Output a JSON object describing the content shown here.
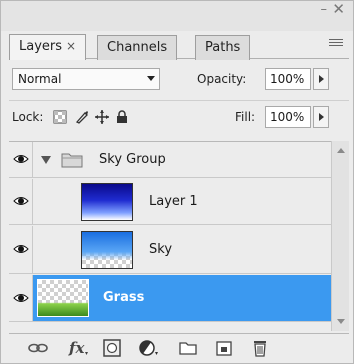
{
  "window": {
    "minimize_glyph": "–",
    "close_glyph": "✕"
  },
  "tabs": [
    {
      "label": "Layers",
      "close_glyph": "×",
      "active": true
    },
    {
      "label": "Channels",
      "active": false
    },
    {
      "label": "Paths",
      "active": false
    }
  ],
  "blend": {
    "mode": "Normal",
    "opacity_label": "Opacity:",
    "opacity_value": "100%",
    "fill_label": "Fill:",
    "fill_value": "100%"
  },
  "lock": {
    "label": "Lock:",
    "icons": [
      "lock-transparent-pixels-icon",
      "lock-image-pixels-icon",
      "lock-position-icon",
      "lock-all-icon"
    ]
  },
  "layers": [
    {
      "name": "Sky Group",
      "type": "group",
      "visible": true,
      "expanded": true,
      "selected": false
    },
    {
      "name": "Layer 1",
      "type": "layer",
      "visible": true,
      "selected": false,
      "thumb": "blue-gradient"
    },
    {
      "name": "Sky",
      "type": "layer",
      "visible": true,
      "selected": false,
      "thumb": "sky-gradient-transparent"
    },
    {
      "name": "Grass",
      "type": "layer",
      "visible": true,
      "selected": true,
      "thumb": "grass-transparent"
    }
  ],
  "toolbar": {
    "icons": [
      "link-layers-icon",
      "layer-style-icon",
      "add-mask-icon",
      "adjustment-layer-icon",
      "new-group-icon",
      "new-layer-icon",
      "delete-layer-icon"
    ]
  },
  "colors": {
    "selection": "#3b99f0",
    "panel_bg": "#ececec"
  }
}
